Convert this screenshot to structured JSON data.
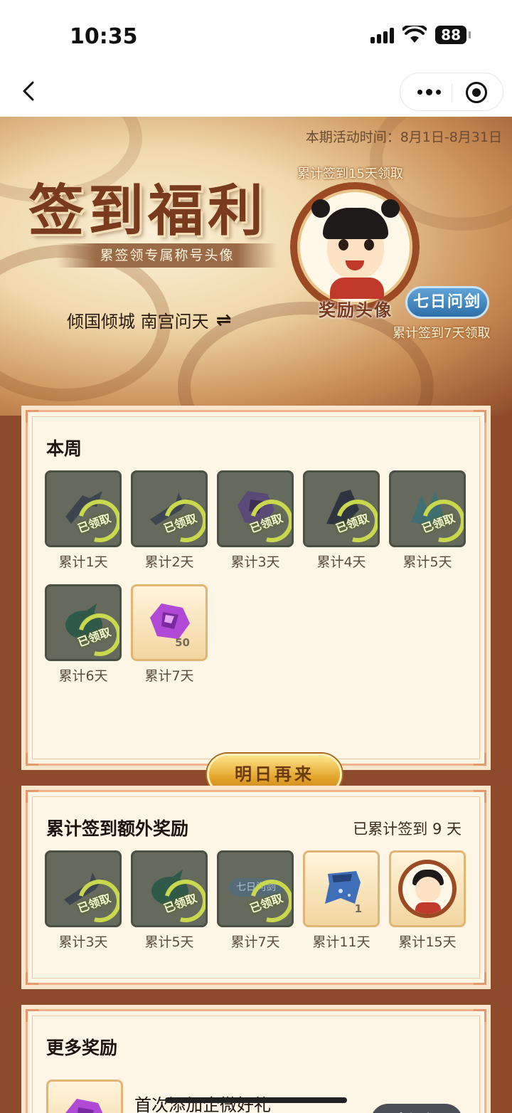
{
  "status_bar": {
    "time": "10:35",
    "battery": "88"
  },
  "banner": {
    "activity_time": "本期活动时间：8月1日-8月31日",
    "title": "签到福利",
    "subtitle": "累签领专属称号头像",
    "character_name": "倾国倾城 南宫问天",
    "swap_icon": "⇌",
    "reward15_label": "累计签到15天领取",
    "avatar_caption": "奖励头像",
    "title_badge": "七日问剑",
    "reward7_label": "累计签到7天领取"
  },
  "weekly": {
    "title": "本周",
    "claimed_text": "已领取",
    "items": [
      {
        "label": "累计1天",
        "state": "claimed",
        "icon": "shovel-icon"
      },
      {
        "label": "累计2天",
        "state": "claimed",
        "icon": "broken-sword-icon"
      },
      {
        "label": "累计3天",
        "state": "claimed",
        "icon": "purple-gem-icon"
      },
      {
        "label": "累计4天",
        "state": "claimed",
        "icon": "dark-crystal-icon"
      },
      {
        "label": "累计5天",
        "state": "claimed",
        "icon": "teal-crystal-icon"
      },
      {
        "label": "累计6天",
        "state": "claimed",
        "icon": "green-pouch-icon"
      },
      {
        "label": "累计7天",
        "state": "available",
        "icon": "purple-gem-icon",
        "qty": "50"
      }
    ],
    "button": "明日再来"
  },
  "cumulative": {
    "title": "累计签到额外奖励",
    "progress_text": "已累计签到 9 天",
    "items": [
      {
        "label": "累计3天",
        "state": "claimed",
        "icon": "broken-sword-icon"
      },
      {
        "label": "累计5天",
        "state": "claimed",
        "icon": "green-pouch-icon"
      },
      {
        "label": "累计7天",
        "state": "claimed",
        "icon": "title-badge-icon",
        "badge_text": "七日问剑"
      },
      {
        "label": "累计11天",
        "state": "available",
        "icon": "blue-cape-icon",
        "qty": "1"
      },
      {
        "label": "累计15天",
        "state": "available",
        "icon": "avatar-reward-icon"
      }
    ]
  },
  "more": {
    "title": "更多奖励",
    "item_title": "首次添加企微好礼",
    "go_button": "去添加"
  },
  "colors": {
    "panel_bg": "#fdf6e6",
    "panel_border": "#f1b48a",
    "claimed_tile": "#656a5c",
    "claimed_ring": "#c9d84c",
    "gold_button": "#e3a42a",
    "page_bg": "#8c4a2a"
  }
}
